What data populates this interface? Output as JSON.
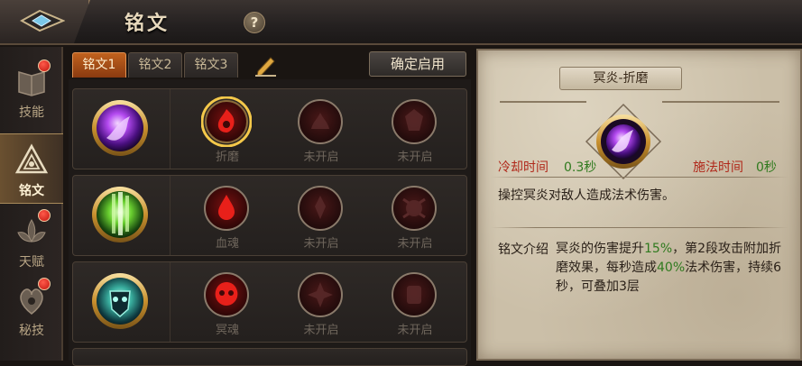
{
  "header": {
    "title": "铭文",
    "help_glyph": "?"
  },
  "sidebar": {
    "items": [
      {
        "label": "技能",
        "icon": "skill-book-icon",
        "badge": true,
        "active": false
      },
      {
        "label": "铭文",
        "icon": "rune-triangle-icon",
        "badge": false,
        "active": true
      },
      {
        "label": "天赋",
        "icon": "talent-lotus-icon",
        "badge": true,
        "active": false
      },
      {
        "label": "秘技",
        "icon": "secret-art-icon",
        "badge": true,
        "active": false
      }
    ]
  },
  "tabs": [
    {
      "label": "铭文1",
      "active": true
    },
    {
      "label": "铭文2",
      "active": false
    },
    {
      "label": "铭文3",
      "active": false
    }
  ],
  "confirm_label": "确定启用",
  "rows": [
    {
      "skill_icon": "dark-flame-skill-icon",
      "slots": [
        {
          "label": "折磨",
          "unlocked": true,
          "selected": true
        },
        {
          "label": "未开启",
          "unlocked": false,
          "selected": false
        },
        {
          "label": "未开启",
          "unlocked": false,
          "selected": false
        }
      ]
    },
    {
      "skill_icon": "green-pillar-skill-icon",
      "slots": [
        {
          "label": "血魂",
          "unlocked": true,
          "selected": false
        },
        {
          "label": "未开启",
          "unlocked": false,
          "selected": false
        },
        {
          "label": "未开启",
          "unlocked": false,
          "selected": false
        }
      ]
    },
    {
      "skill_icon": "undead-warrior-skill-icon",
      "slots": [
        {
          "label": "冥魂",
          "unlocked": true,
          "selected": false
        },
        {
          "label": "未开启",
          "unlocked": false,
          "selected": false
        },
        {
          "label": "未开启",
          "unlocked": false,
          "selected": false
        }
      ]
    }
  ],
  "detail": {
    "title": "冥炎-折磨",
    "cooldown_label": "冷却时间",
    "cooldown_value": "0.3秒",
    "cast_label": "施法时间",
    "cast_value": "0秒",
    "description": "操控冥炎对敌人造成法术伤害。",
    "intro_label": "铭文介绍",
    "intro_parts": {
      "p1": "冥炎的伤害提升",
      "v1": "15%",
      "p2": "，第2段攻击附加折磨效果，每秒造成",
      "v2": "40%",
      "p3": "法术伤害，持续6秒，可叠加3层"
    }
  },
  "colors": {
    "accent_orange": "#c0621e",
    "highlight_green": "#2f7a1e",
    "label_red": "#b0281a",
    "badge_red": "#e0281a"
  }
}
